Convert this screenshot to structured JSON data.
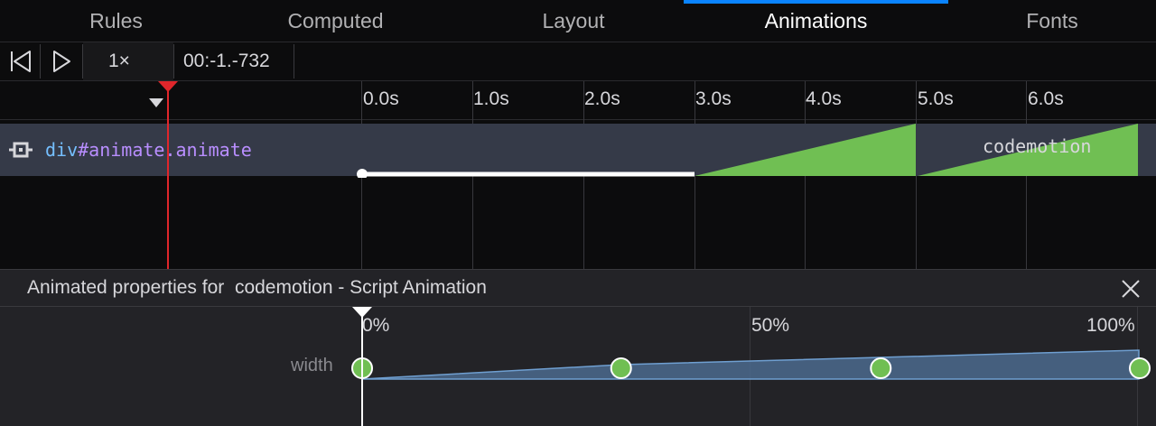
{
  "tabs": [
    {
      "label": "Rules",
      "active": false
    },
    {
      "label": "Computed",
      "active": false
    },
    {
      "label": "Layout",
      "active": false
    },
    {
      "label": "Animations",
      "active": true
    },
    {
      "label": "Fonts",
      "active": false
    }
  ],
  "toolbar": {
    "rewind_icon": "rewind-icon",
    "play_icon": "play-icon",
    "playback_rate": "1×",
    "current_time": "00:-1.-732"
  },
  "timeline": {
    "ticks": [
      "0.0s",
      "1.0s",
      "2.0s",
      "3.0s",
      "4.0s",
      "5.0s",
      "6.0s"
    ]
  },
  "animation": {
    "target_tag": "div",
    "target_selector": "#animate.animate",
    "name": "codemotion",
    "delay_s": 3.0,
    "iteration_duration_s": 2.0,
    "iterations": 2
  },
  "panel": {
    "title": "Animated properties for  codemotion - Script Animation",
    "percent_labels": [
      "0%",
      "50%",
      "100%"
    ],
    "property": "width",
    "keyframes": [
      0,
      0.333,
      0.667,
      1.0
    ]
  },
  "colors": {
    "accent": "#0a84ff",
    "iteration_fill": "#70bf53",
    "scrubber": "#e0262b",
    "tag": "#75bfff",
    "selector": "#b98eff"
  }
}
